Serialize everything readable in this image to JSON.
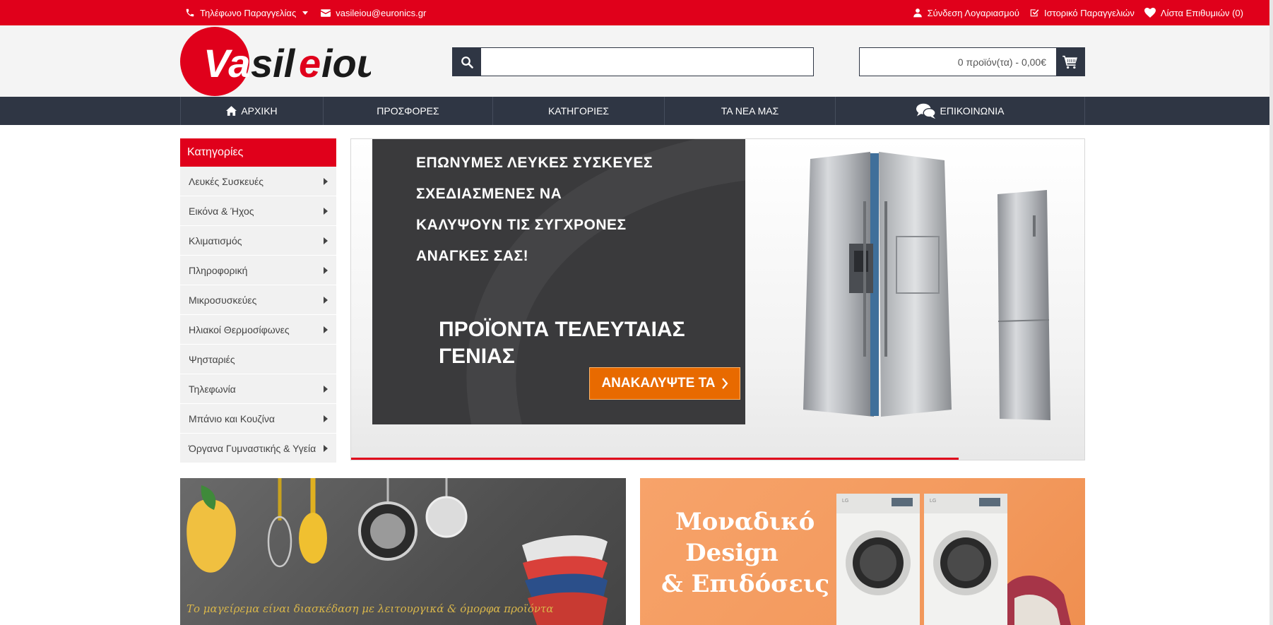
{
  "topbar": {
    "phone_label": "Τηλέφωνο Παραγγελίας",
    "email": "vasileiou@euronics.gr",
    "login": "Σύνδεση Λογαριασμού",
    "order_history": "Ιστορικό Παραγγελιών",
    "wishlist": "Λίστα Επιθυμιών (0)"
  },
  "logo": {
    "text": "Vasileiou",
    "colors": {
      "red": "#e0001b",
      "dark": "#1a1a1a"
    }
  },
  "search": {
    "value": "",
    "placeholder": ""
  },
  "cart": {
    "summary": "0 προϊόν(τα) - 0,00€"
  },
  "nav": {
    "home": "ΑΡΧΙΚΗ",
    "offers": "ΠΡΟΣΦΟΡΕΣ",
    "categories": "ΚΑΤΗΓΟΡΙΕΣ",
    "news": "ΤΑ ΝΕΑ ΜΑΣ",
    "contact": "ΕΠΙΚΟΙΝΩΝΙΑ"
  },
  "categories": {
    "title": "Κατηγορίες",
    "items": [
      {
        "label": "Λευκές Συσκευές",
        "has_sub": true
      },
      {
        "label": "Εικόνα & Ήχος",
        "has_sub": true
      },
      {
        "label": "Κλιματισμός",
        "has_sub": true
      },
      {
        "label": "Πληροφορική",
        "has_sub": true
      },
      {
        "label": "Μικροσυσκεύες",
        "has_sub": true
      },
      {
        "label": "Ηλιακοί Θερμοσίφωνες",
        "has_sub": true
      },
      {
        "label": "Ψησταριές",
        "has_sub": false
      },
      {
        "label": "Τηλεφωνία",
        "has_sub": true
      },
      {
        "label": "Μπάνιο και Κουζίνα",
        "has_sub": true
      },
      {
        "label": "Όργανα Γυμναστικής & Υγεία",
        "has_sub": true
      }
    ]
  },
  "hero": {
    "lines": [
      "ΕΠΩΝΥΜΕΣ ΛΕΥΚΕΣ ΣΥΣΚΕΥΕΣ",
      "ΣΧΕΔΙΑΣΜΕΝΕΣ ΝΑ",
      "ΚΑΛΥΨΟΥΝ ΤΙΣ ΣΥΓΧΡΟΝΕΣ",
      "ΑΝΑΓΚΕΣ ΣΑΣ!"
    ],
    "big_lines": [
      "ΠΡΟΪΟΝΤΑ ΤΕΛΕΥΤΑΙΑΣ",
      "ΓΕΝΙΑΣ"
    ],
    "cta": "ΑΝΑΚΑΛΥΨΤΕ ΤΑ"
  },
  "banner_kitchen": {
    "caption": "Το μαγείρεμα είναι διασκέδαση με λειτουργικά & όμορφα προϊόντα"
  },
  "banner_washers": {
    "lines": [
      "Μοναδικό",
      "Design",
      "& Επιδόσεις"
    ],
    "brand": "LG"
  }
}
